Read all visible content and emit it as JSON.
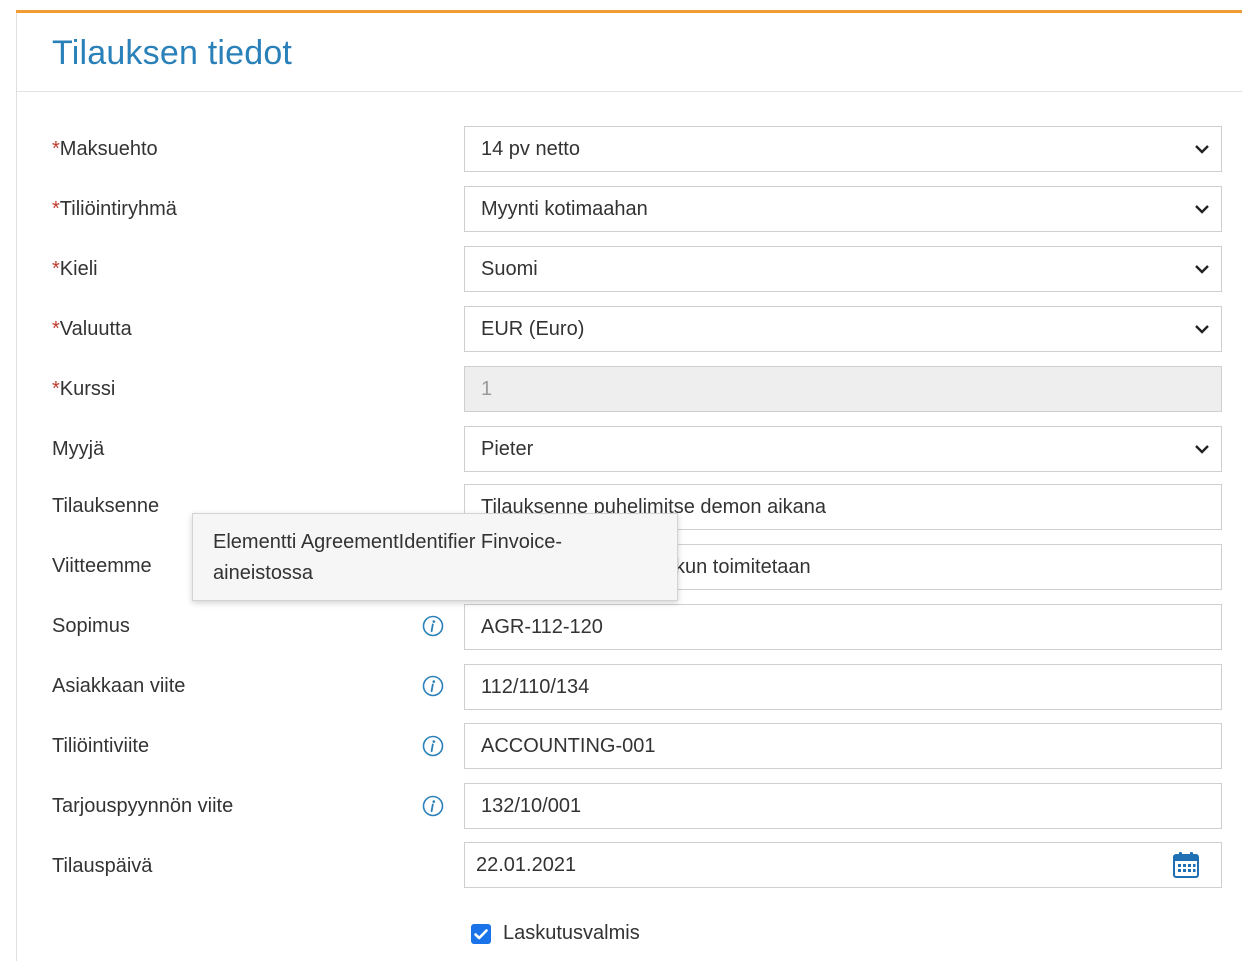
{
  "section": {
    "title": "Tilauksen tiedot"
  },
  "fields": {
    "maksuehto": {
      "required_mark": "*",
      "label": "Maksuehto",
      "value": "14 pv netto"
    },
    "tiliointiryhma": {
      "required_mark": "*",
      "label": "Tiliöintiryhmä",
      "value": "Myynti kotimaahan"
    },
    "kieli": {
      "required_mark": "*",
      "label": "Kieli",
      "value": "Suomi"
    },
    "valuutta": {
      "required_mark": "*",
      "label": "Valuutta",
      "value": "EUR (Euro)"
    },
    "kurssi": {
      "required_mark": "*",
      "label": "Kurssi",
      "value": "1"
    },
    "myyja": {
      "label": "Myyjä",
      "value": "Pieter"
    },
    "tilauksenne": {
      "label": "Tilauksenne",
      "value": "Tilauksenne puhelimitse demon aikana"
    },
    "viitteemme": {
      "label": "Viitteemme",
      "value": "kun toimitetaan"
    },
    "sopimus": {
      "label": "Sopimus",
      "value": "AGR-112-120"
    },
    "asiakkaan_viite": {
      "label": "Asiakkaan viite",
      "value": "112/110/134"
    },
    "tiliointiviite": {
      "label": "Tiliöintiviite",
      "value": "ACCOUNTING-001"
    },
    "tarjouspyynnon_viite": {
      "label": "Tarjouspyynnön viite",
      "value": "132/10/001"
    },
    "tilauspaiva": {
      "label": "Tilauspäivä",
      "value": "22.01.2021"
    }
  },
  "tooltip": {
    "text": "Elementti AgreementIdentifier Finvoice-aineistossa"
  },
  "laskutusvalmis": {
    "label": "Laskutusvalmis",
    "checked": true
  },
  "icons": {
    "select": "chevron-down-icon",
    "info": "info-icon",
    "date": "calendar-icon",
    "checkbox": "checkmark-icon"
  },
  "colors": {
    "accent_top": "#f39c32",
    "title": "#2a80b9",
    "required": "#c0392b",
    "info_icon": "#2a80b9",
    "checkbox": "#1a73e8"
  }
}
